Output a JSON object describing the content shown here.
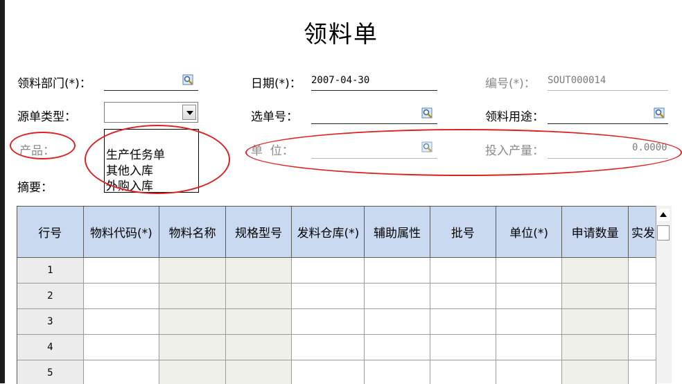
{
  "title": "领料单",
  "form": {
    "dept_label": "领料部门(*)：",
    "date_label": "日期(*)：",
    "date_value": "2007-04-30",
    "number_label": "编号(*)：",
    "number_value": "SOUT000014",
    "source_type_label": "源单类型：",
    "select_no_label": "选单号：",
    "purpose_label": "领料用途：",
    "product_label": "产品：",
    "unit_label": "单  位：",
    "input_qty_label": "投入产量：",
    "input_qty_value": "0.0000",
    "summary_label": "摘要："
  },
  "source_type_dropdown": {
    "options": [
      "生产任务单",
      "其他入库",
      "外购入库"
    ]
  },
  "grid": {
    "columns": [
      "行号",
      "物料代码(*)",
      "物料名称",
      "规格型号",
      "发料仓库(*)",
      "辅助属性",
      "批号",
      "单位(*)",
      "申请数量",
      "实发"
    ],
    "rows": [
      "1",
      "2",
      "3",
      "4",
      "5"
    ]
  },
  "colors": {
    "header_bg": "#c9daf0",
    "highlight": "#e02020"
  }
}
